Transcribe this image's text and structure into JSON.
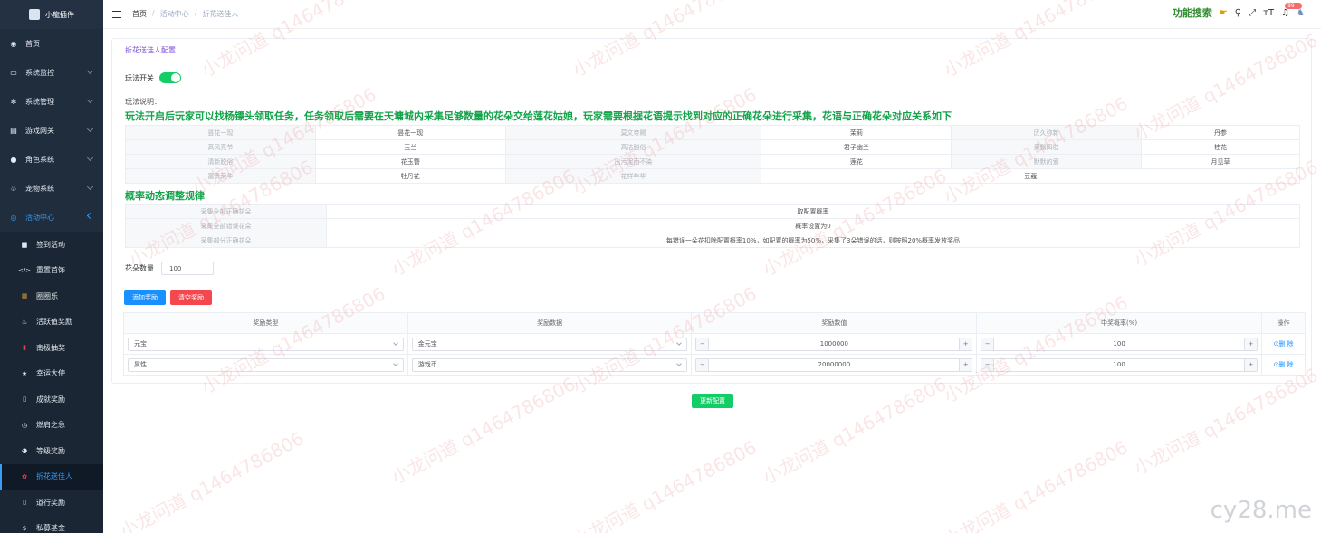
{
  "app": {
    "title": "小龍插件"
  },
  "sidebar": {
    "items": [
      {
        "label": "首页",
        "icon": "dashboard-icon"
      },
      {
        "label": "系统监控",
        "icon": "monitor-icon",
        "arrow": true
      },
      {
        "label": "系统管理",
        "icon": "gear-icon",
        "arrow": true
      },
      {
        "label": "游戏网关",
        "icon": "server-icon",
        "arrow": true
      },
      {
        "label": "角色系统",
        "icon": "user-icon",
        "arrow": true
      },
      {
        "label": "宠物系统",
        "icon": "pet-icon",
        "arrow": true
      },
      {
        "label": "活动中心",
        "icon": "activity-icon",
        "open": true
      }
    ],
    "subitems": [
      {
        "label": "签到活动",
        "icon": "doc-icon"
      },
      {
        "label": "重置首饰",
        "icon": "code-icon"
      },
      {
        "label": "圈圈乐",
        "icon": "box-icon"
      },
      {
        "label": "活跃值奖励",
        "icon": "lock-icon"
      },
      {
        "label": "南极抽奖",
        "icon": "gift-icon"
      },
      {
        "label": "幸运大使",
        "icon": "star-icon"
      },
      {
        "label": "成就奖励",
        "icon": "book-icon"
      },
      {
        "label": "燃肩之急",
        "icon": "clock-icon"
      },
      {
        "label": "等级奖励",
        "icon": "gauge-icon"
      },
      {
        "label": "折花送佳人",
        "icon": "flower-icon",
        "active": true
      },
      {
        "label": "道行奖励",
        "icon": "book-icon"
      },
      {
        "label": "私募基金",
        "icon": "money-icon"
      }
    ]
  },
  "breadcrumb": [
    "首页",
    "活动中心",
    "折花送佳人"
  ],
  "topbar": {
    "feature_search": "功能搜索",
    "badge": "99+"
  },
  "card": {
    "title": "折花送佳人配置",
    "switch_label": "玩法开关",
    "desc_label": "玩法说明：",
    "desc_text": "玩法开启后玩家可以找杨镖头领取任务，任务领取后需要在天墉城内采集足够数量的花朵交给莲花姑娘，玩家需要根据花语提示找到对应的正确花朵进行采集，花语与正确花朵对应关系如下",
    "flower_table": [
      [
        "昙花一现",
        "昙花一现",
        "莫文帝赐",
        "茉莉",
        "历久弥新",
        "丹参"
      ],
      [
        "高风亮节",
        "玉兰",
        "高洁脱俗",
        "君子幽兰",
        "黄飘四溢",
        "桂花"
      ],
      [
        "清新脱俗",
        "花玉簪",
        "出污泥而不染",
        "莲花",
        "默默的爱",
        "月见草"
      ],
      [
        "富贵荣华",
        "牡丹花",
        "花样年华",
        "豆蔻"
      ]
    ],
    "prob_title": "概率动态调整规律",
    "prob_table": [
      [
        "采集全部正确花朵",
        "取配置概率"
      ],
      [
        "采集全部错误花朵",
        "概率设置为0"
      ],
      [
        "采集部分正确花朵",
        "每错误一朵花扣除配置概率10%，如配置的概率为50%，采集了3朵错误的话，则按照20%概率发放奖品"
      ]
    ],
    "count_label": "花朵数量",
    "count_value": "100",
    "add_button": "添加奖励",
    "clear_button": "清空奖励",
    "reward_headers": [
      "奖励类型",
      "奖励数据",
      "奖励数值",
      "中奖概率(%)",
      "操作"
    ],
    "rewards": [
      {
        "type": "元宝",
        "data": "金元宝",
        "amount": "1000000",
        "prob": "100",
        "op": "⊙删 除"
      },
      {
        "type": "属性",
        "data": "游戏币",
        "amount": "20000000",
        "prob": "100",
        "op": "⊙删 除"
      }
    ]
  },
  "update_button": "更新配置",
  "watermark": "小龙问道 q1464786806",
  "site_mark": "cy28.me"
}
